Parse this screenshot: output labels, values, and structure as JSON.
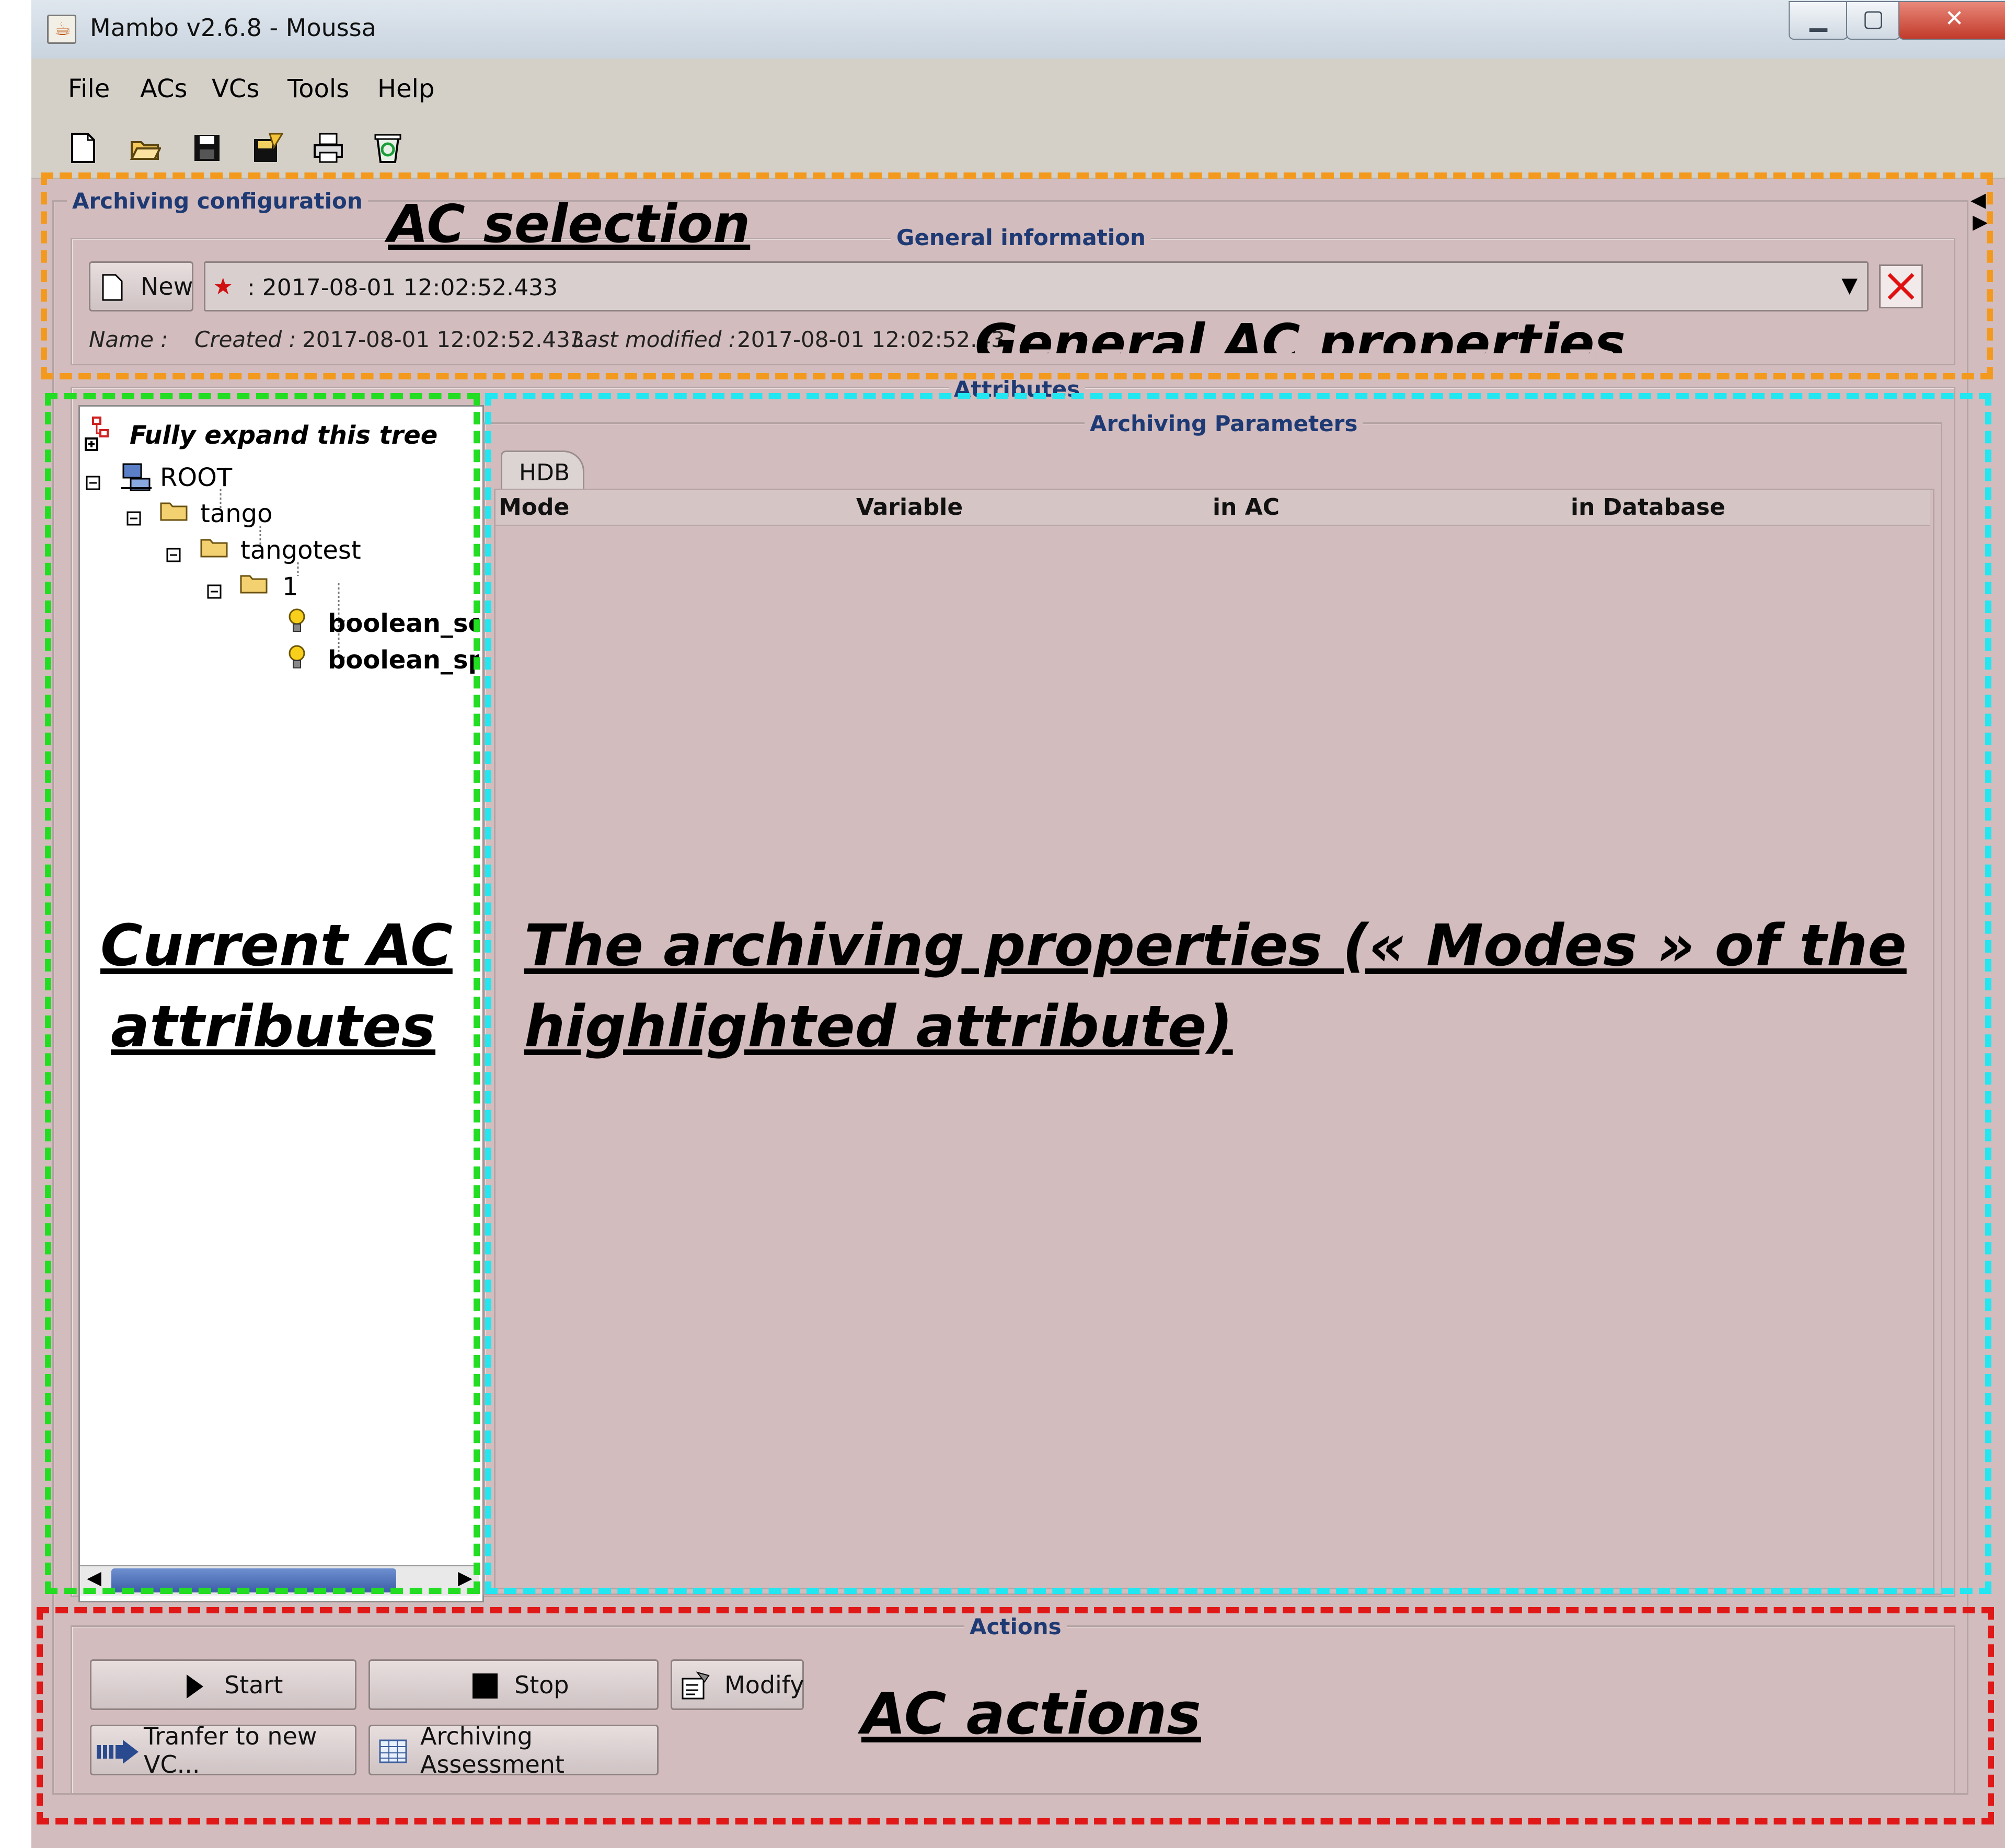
{
  "window": {
    "title": "Mambo v2.6.8 - Moussa"
  },
  "menu": [
    "File",
    "ACs",
    "VCs",
    "Tools",
    "Help"
  ],
  "toolbar_icons": [
    "new-file-icon",
    "open-folder-icon",
    "save-icon",
    "save-as-icon",
    "print-icon",
    "recycle-bin-icon"
  ],
  "archiving_configuration": {
    "label": "Archiving configuration",
    "general_information": {
      "label": "General information",
      "new_button": "New",
      "selected_ac": ": 2017-08-01 12:02:52.433",
      "name_label": "Name :",
      "created_label": "Created :",
      "created_value": "2017-08-01 12:02:52.433",
      "modified_label": "Last modified :",
      "modified_value": "2017-08-01 12:02:52.43"
    },
    "attributes": {
      "label": "Attributes",
      "expand_tree": "Fully expand this tree",
      "tree": {
        "root": "ROOT",
        "level1": "tango",
        "level2": "tangotest",
        "level3": "1",
        "leaves": [
          "boolean_scal",
          "boolean_spe"
        ]
      }
    },
    "archiving_parameters": {
      "label": "Archiving Parameters",
      "tab": "HDB",
      "columns": [
        "Mode",
        "Variable",
        "in AC",
        "in Database"
      ]
    },
    "actions": {
      "label": "Actions",
      "start": "Start",
      "stop": "Stop",
      "modify": "Modify",
      "transfer": "Tranfer to new VC...",
      "assessment": "Archiving Assessment"
    }
  },
  "annotations": {
    "ac_selection": "AC selection",
    "general_properties": "General AC properties",
    "current_attributes_line1": "Current AC",
    "current_attributes_line2": "attributes",
    "archiving_properties_line1": "The archiving properties (« Modes » of the",
    "archiving_properties_line2": "highlighted attribute)",
    "ac_actions": "AC actions"
  },
  "colors": {
    "panel_background": "#d3bcbd",
    "orange_dash": "#f39a1e",
    "green_dash": "#22dd22",
    "cyan_dash": "#22e6f0",
    "red_dash": "#e01818",
    "group_label": "#1e3a74"
  }
}
